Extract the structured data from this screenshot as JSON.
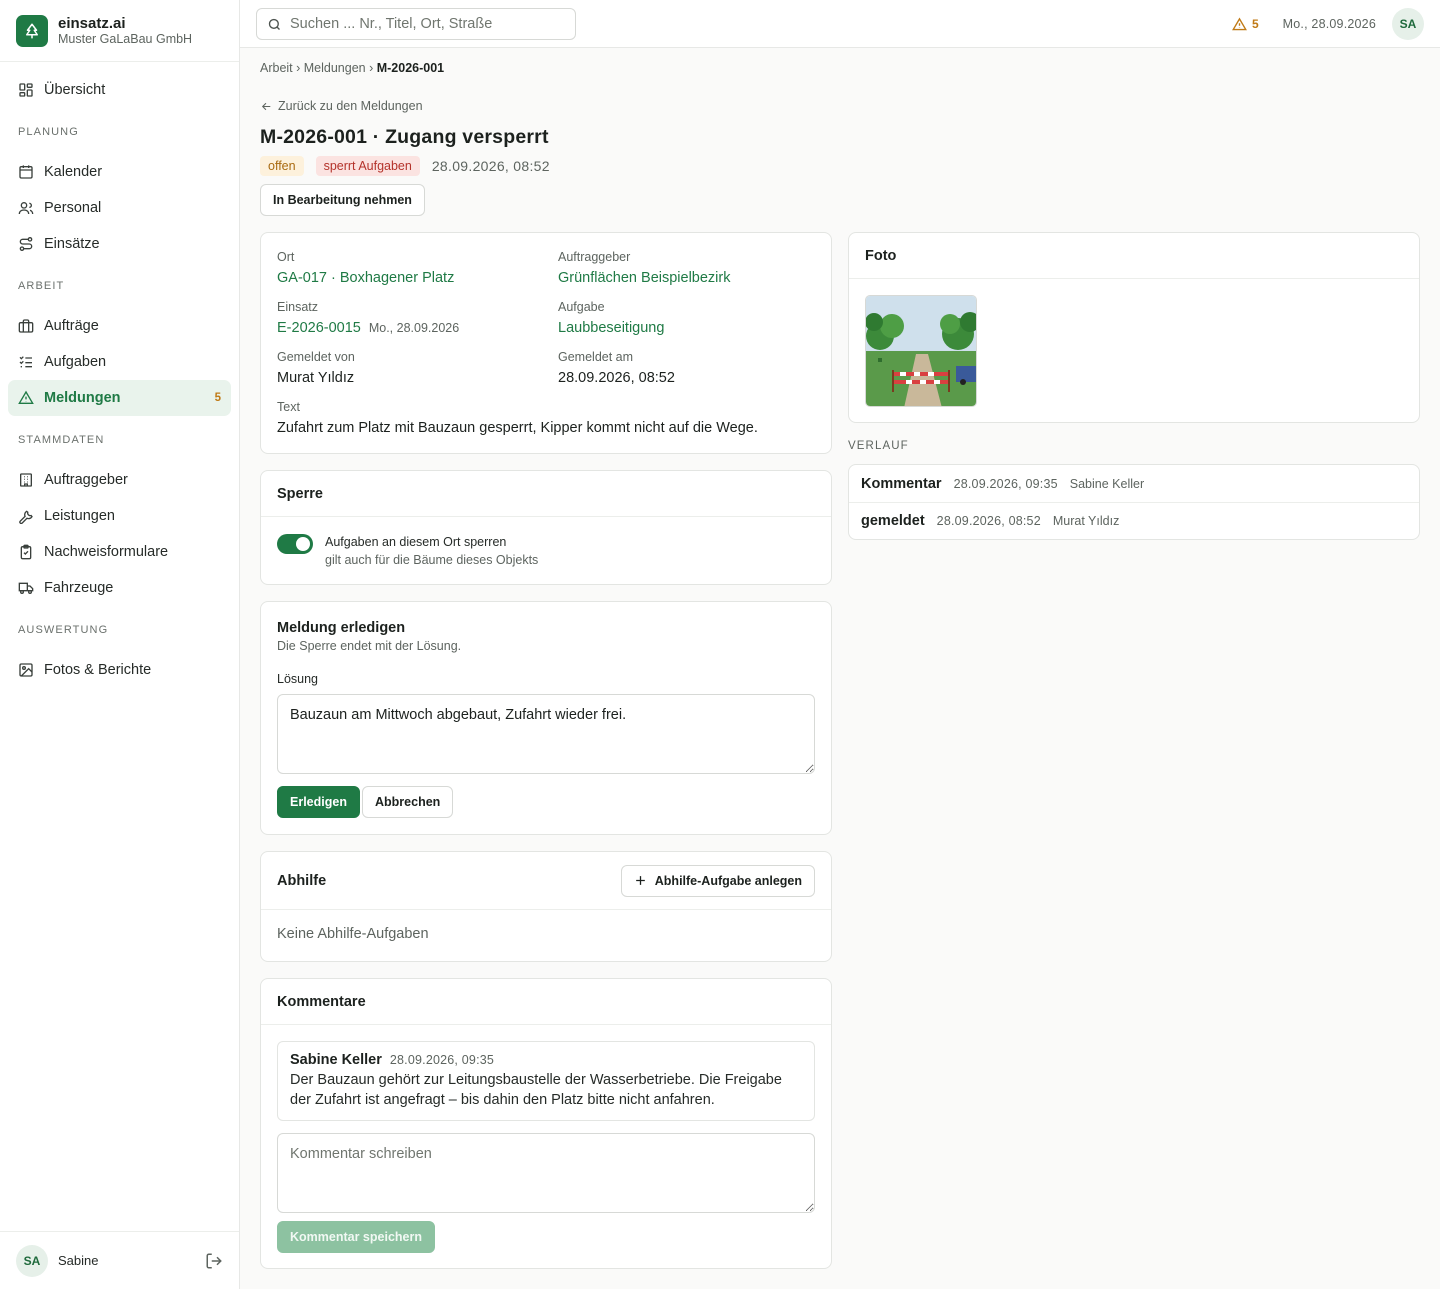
{
  "app": {
    "name": "einsatz.ai",
    "company": "Muster GaLaBau GmbH"
  },
  "sidebar": {
    "overview": {
      "label": "Übersicht"
    },
    "sections": {
      "planung": "PLANUNG",
      "arbeit": "ARBEIT",
      "stammdaten": "STAMMDATEN",
      "auswertung": "AUSWERTUNG"
    },
    "items": {
      "kalender": "Kalender",
      "personal": "Personal",
      "einsaetze": "Einsätze",
      "auftraege": "Aufträge",
      "aufgaben": "Aufgaben",
      "meldungen": {
        "label": "Meldungen",
        "badge": "5"
      },
      "auftraggeber": "Auftraggeber",
      "leistungen": "Leistungen",
      "nachweisformulare": "Nachweisformulare",
      "fahrzeuge": "Fahrzeuge",
      "fotos": "Fotos & Berichte"
    },
    "user": {
      "initials": "SA",
      "name": "Sabine"
    }
  },
  "topbar": {
    "search_placeholder": "Suchen ... Nr., Titel, Ort, Straße",
    "alert_count": "5",
    "date": "Mo., 28.09.2026",
    "user_initials": "SA"
  },
  "breadcrumb": {
    "items": [
      "Arbeit",
      "Meldungen"
    ],
    "current": "M-2026-001"
  },
  "back_label": "Zurück zu den Meldungen",
  "page_title": "M-2026-001 · Zugang versperrt",
  "status": {
    "open": "offen",
    "lock": "sperrt Aufgaben",
    "date": "28.09.2026, 08:52"
  },
  "actions": {
    "take": "In Bearbeitung nehmen"
  },
  "details": {
    "ort": {
      "label": "Ort",
      "value": "GA-017 · Boxhagener Platz"
    },
    "auftraggeber": {
      "label": "Auftraggeber",
      "value": "Grünflächen Beispielbezirk"
    },
    "einsatz": {
      "label": "Einsatz",
      "value": "E-2026-0015",
      "date": "Mo., 28.09.2026"
    },
    "aufgabe": {
      "label": "Aufgabe",
      "value": "Laubbeseitigung"
    },
    "gemeldet_von": {
      "label": "Gemeldet von",
      "value": "Murat Yıldız"
    },
    "gemeldet_am": {
      "label": "Gemeldet am",
      "value": "28.09.2026, 08:52"
    },
    "text": {
      "label": "Text",
      "value": "Zufahrt zum Platz mit Bauzaun gesperrt, Kipper kommt nicht auf die Wege."
    }
  },
  "sperre": {
    "title": "Sperre",
    "enabled": true,
    "label": "Aufgaben an diesem Ort sperren",
    "hint": "gilt auch für die Bäume dieses Objekts"
  },
  "erledigen": {
    "title": "Meldung erledigen",
    "subtitle": "Die Sperre endet mit der Lösung.",
    "solution_label": "Lösung",
    "solution_value": "Bauzaun am Mittwoch abgebaut, Zufahrt wieder frei.",
    "submit": "Erledigen",
    "cancel": "Abbrechen"
  },
  "abhilfe": {
    "title": "Abhilfe",
    "add": "Abhilfe-Aufgabe anlegen",
    "empty": "Keine Abhilfe-Aufgaben"
  },
  "kommentare": {
    "title": "Kommentare",
    "items": [
      {
        "author": "Sabine Keller",
        "time": "28.09.2026, 09:35",
        "text": "Der Bauzaun gehört zur Leitungsbaustelle der Wasserbetriebe. Die Freigabe der Zufahrt ist angefragt – bis dahin den Platz bitte nicht anfahren."
      }
    ],
    "placeholder": "Kommentar schreiben",
    "save": "Kommentar speichern"
  },
  "foto": {
    "title": "Foto"
  },
  "verlauf": {
    "title": "VERLAUF",
    "items": [
      {
        "type": "Kommentar",
        "time": "28.09.2026, 09:35",
        "user": "Sabine Keller"
      },
      {
        "type": "gemeldet",
        "time": "28.09.2026, 08:52",
        "user": "Murat Yıldız"
      }
    ]
  }
}
